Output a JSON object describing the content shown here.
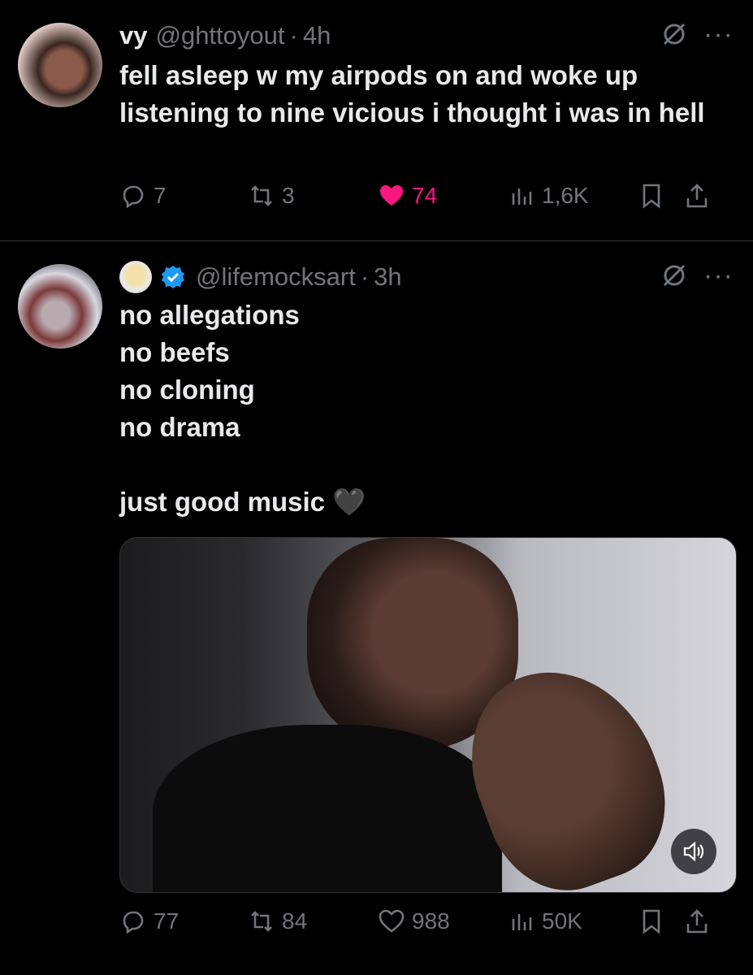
{
  "tweets": [
    {
      "name": "vy",
      "handle": "@ghttoyout",
      "time": "4h",
      "text": "fell asleep w my airpods on and woke up listening to nine vicious i thought i was in hell",
      "replies": "7",
      "reposts": "3",
      "likes": "74",
      "views": "1,6K",
      "liked": true
    },
    {
      "name": "",
      "handle": "@lifemocksart",
      "time": "3h",
      "text": "no allegations\nno beefs\nno cloning\nno drama\n\njust good music 🖤",
      "replies": "77",
      "reposts": "84",
      "likes": "988",
      "views": "50K",
      "liked": false,
      "has_video": true
    }
  ],
  "separator": "·",
  "colors": {
    "like": "#f91880",
    "muted": "#71767b",
    "verified": "#1d9bf0"
  }
}
